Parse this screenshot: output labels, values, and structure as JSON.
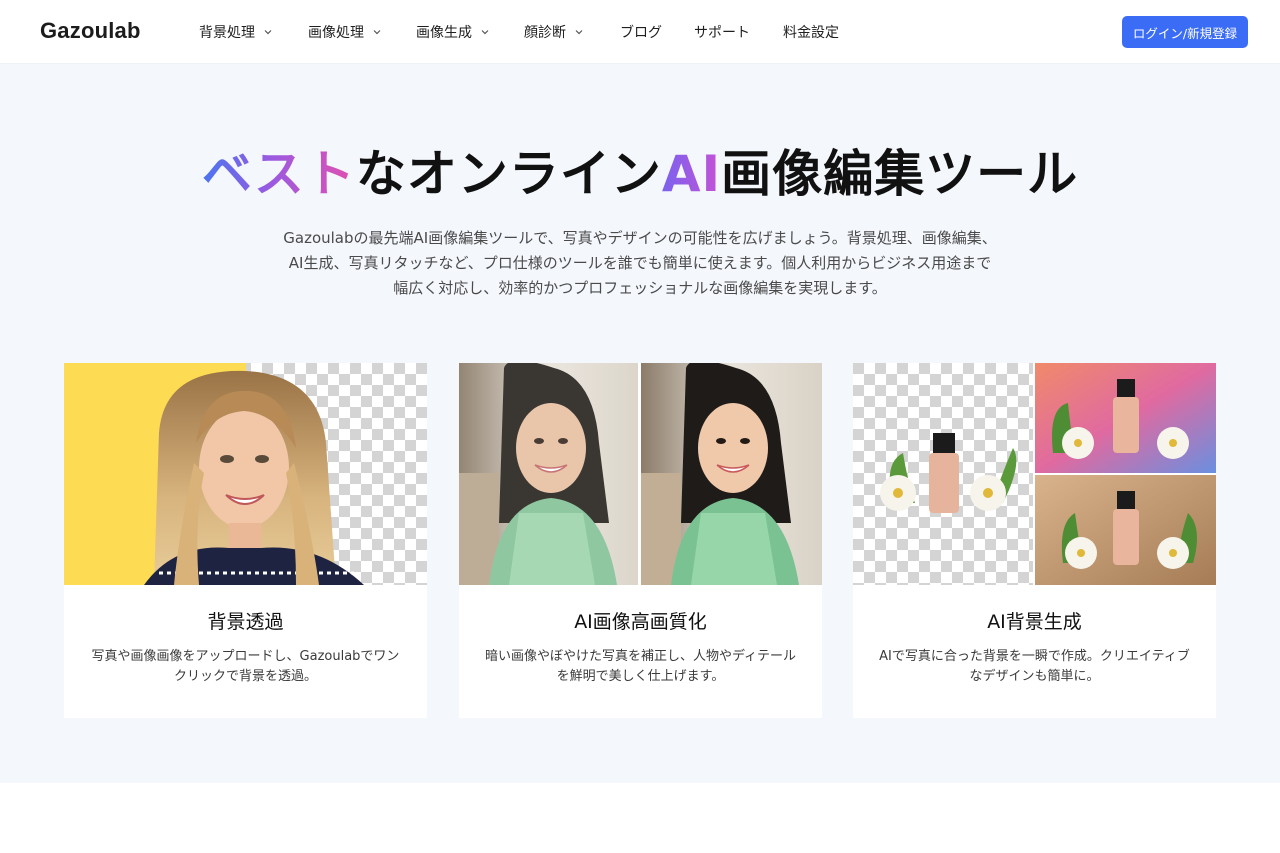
{
  "header": {
    "logo": "Gazoulab",
    "nav": [
      {
        "label": "背景処理",
        "dropdown": true
      },
      {
        "label": "画像処理",
        "dropdown": true
      },
      {
        "label": "画像生成",
        "dropdown": true
      },
      {
        "label": "顔診断",
        "dropdown": true
      },
      {
        "label": "ブログ",
        "dropdown": false
      },
      {
        "label": "サポート",
        "dropdown": false
      },
      {
        "label": "料金設定",
        "dropdown": false
      }
    ],
    "login_label": "ログイン/新規登録"
  },
  "hero": {
    "title_part1": "ベスト",
    "title_part2": "なオンライン",
    "title_part3": "AI",
    "title_part4": "画像編集ツール",
    "description_lines": [
      "Gazoulabの最先端AI画像編集ツールで、写真やデザインの可能性を広げましょう。背景処理、画像編集、",
      "AI生成、写真リタッチなど、プロ仕様のツールを誰でも簡単に使えます。個人利用からビジネス用途まで",
      "幅広く対応し、効率的かつプロフェッショナルな画像編集を実現します。"
    ]
  },
  "cards": [
    {
      "title": "背景透過",
      "description": "写真や画像画像をアップロードし、Gazoulabでワンクリックで背景を透過。"
    },
    {
      "title": "AI画像高画質化",
      "description": "暗い画像やぼやけた写真を補正し、人物やディテールを鮮明で美しく仕上げます。"
    },
    {
      "title": "AI背景生成",
      "description": "AIで写真に合った背景を一瞬で作成。クリエイティブなデザインも簡単に。"
    }
  ],
  "colors": {
    "accent": "#3b6cf6",
    "hero_bg": "#f4f7fc",
    "gradient_start": "#4a74f0",
    "gradient_end": "#e34fb0"
  }
}
